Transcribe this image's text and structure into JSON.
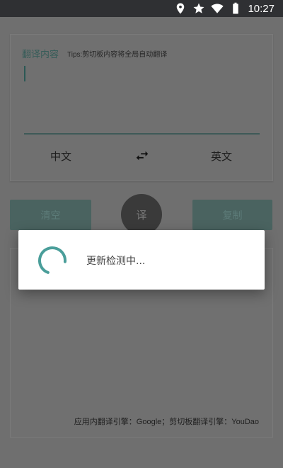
{
  "status_bar": {
    "time": "10:27",
    "icons": [
      "location-icon",
      "star-icon",
      "wifi-icon",
      "battery-icon"
    ]
  },
  "input_card": {
    "label": "翻译内容",
    "tips": "Tips:剪切板内容将全局自动翻译",
    "text_value": ""
  },
  "languages": {
    "source": "中文",
    "target": "英文",
    "swap_icon": "swap-icon"
  },
  "buttons": {
    "clear_label": "清空",
    "translate_label": "译",
    "copy_label": "复制"
  },
  "output_card": {
    "engine_info": "应用内翻译引擎：Google；剪切板翻译引擎：YouDao"
  },
  "dialog": {
    "message": "更新检测中..."
  },
  "colors": {
    "accent": "#4a9e9a",
    "status_bar": "#2f3033",
    "scrim_background": "#6f6f6f",
    "dialog_background": "#ffffff"
  }
}
